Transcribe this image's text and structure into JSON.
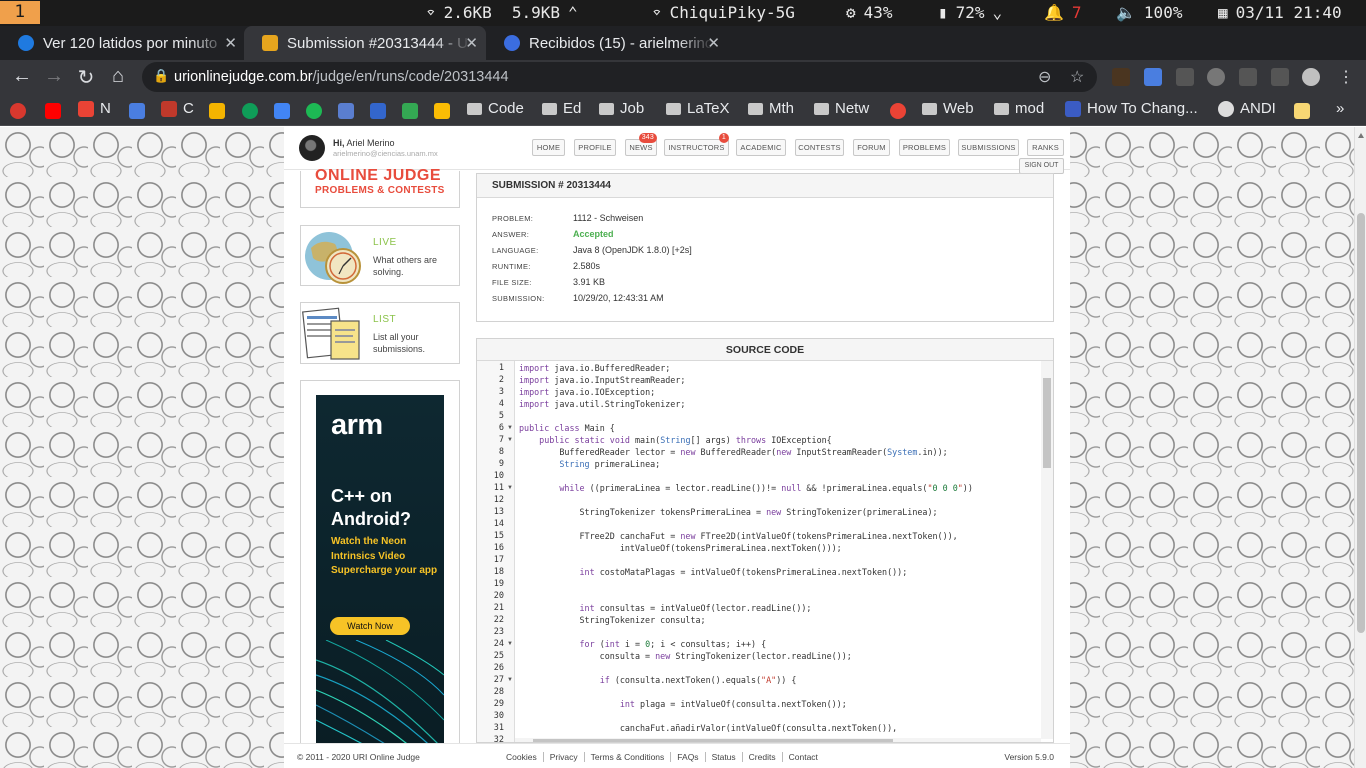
{
  "system": {
    "workspace": "1",
    "net_down": "2.6KB",
    "net_up": "5.9KB",
    "wifi": "ChiquiPiky-5G",
    "cpu": "43%",
    "battery": "72%",
    "notif_count": "7",
    "volume": "100%",
    "datetime": "03/11 21:40"
  },
  "tabs": [
    {
      "title": "Ver 120 latidos por minuto",
      "icon": "edge-icon",
      "color": "#1f7ae0"
    },
    {
      "title": "Submission #20313444 - U",
      "icon": "trophy-icon",
      "color": "#e6a51e"
    },
    {
      "title": "Recibidos (15) - arielmerino",
      "icon": "mail-icon",
      "color": "#3b6de0"
    }
  ],
  "url": {
    "host": "urionlinejudge.com.br",
    "path": "/judge/en/runs/code/20313444"
  },
  "bookmarks": [
    "N",
    "C",
    "Code",
    "Ed",
    "Job",
    "LaTeX",
    "Mth",
    "Netw",
    "Web",
    "mod",
    "How To Chang...",
    "ANDI"
  ],
  "user": {
    "greeting": "Hi,",
    "name": "Ariel Merino",
    "email": "arielmerino@ciencias.unam.mx"
  },
  "menu": [
    {
      "label": "HOME",
      "badge": ""
    },
    {
      "label": "PROFILE",
      "badge": ""
    },
    {
      "label": "NEWS",
      "badge": "343"
    },
    {
      "label": "INSTRUCTORS",
      "badge": "1"
    },
    {
      "label": "ACADEMIC",
      "badge": ""
    },
    {
      "label": "CONTESTS",
      "badge": ""
    },
    {
      "label": "FORUM",
      "badge": ""
    },
    {
      "label": "PROBLEMS",
      "badge": ""
    },
    {
      "label": "SUBMISSIONS",
      "badge": ""
    },
    {
      "label": "RANKS",
      "badge": ""
    }
  ],
  "signout": "SIGN OUT",
  "logo": {
    "line1": "ONLINE JUDGE",
    "line2": "PROBLEMS & CONTESTS"
  },
  "sidebar": [
    {
      "title": "LIVE",
      "desc": "What others are solving."
    },
    {
      "title": "LIST",
      "desc": "List all your submissions."
    }
  ],
  "ad": {
    "brand": "arm",
    "headline": "C++ on Android?",
    "sub": "Watch the Neon Intrinsics Video Supercharge your app",
    "button": "Watch Now"
  },
  "submission": {
    "title": "SUBMISSION # 20313444",
    "rows": [
      {
        "label": "PROBLEM:",
        "value": "1112 - Schweisen"
      },
      {
        "label": "ANSWER:",
        "value": "Accepted"
      },
      {
        "label": "LANGUAGE:",
        "value": "Java 8 (OpenJDK 1.8.0) [+2s]"
      },
      {
        "label": "RUNTIME:",
        "value": "2.580s"
      },
      {
        "label": "FILE SIZE:",
        "value": "3.91 KB"
      },
      {
        "label": "SUBMISSION:",
        "value": "10/29/20, 12:43:31 AM"
      }
    ]
  },
  "source": {
    "title": "SOURCE CODE",
    "lines": [
      "import java.io.BufferedReader;",
      "import java.io.InputStreamReader;",
      "import java.io.IOException;",
      "import java.util.StringTokenizer;",
      "",
      "public class Main {",
      "    public static void main(String[] args) throws IOException{",
      "        BufferedReader lector = new BufferedReader(new InputStreamReader(System.in));",
      "        String primeraLinea;",
      "",
      "        while ((primeraLinea = lector.readLine())!= null && !primeraLinea.equals(\"0 0 0\"))",
      "",
      "            StringTokenizer tokensPrimeraLinea = new StringTokenizer(primeraLinea);",
      "",
      "            FTree2D canchaFut = new FTree2D(intValueOf(tokensPrimeraLinea.nextToken()),",
      "                    intValueOf(tokensPrimeraLinea.nextToken()));",
      "",
      "            int costoMataPlagas = intValueOf(tokensPrimeraLinea.nextToken());",
      "",
      "",
      "            int consultas = intValueOf(lector.readLine());",
      "            StringTokenizer consulta;",
      "",
      "            for (int i = 0; i < consultas; i++) {",
      "                consulta = new StringTokenizer(lector.readLine());",
      "",
      "                if (consulta.nextToken().equals(\"A\")) {",
      "",
      "                    int plaga = intValueOf(consulta.nextToken());",
      "",
      "                    canchaFut.añadirValor(intValueOf(consulta.nextToken()),",
      ""
    ],
    "fold_lines": [
      6,
      7,
      11,
      24,
      27
    ]
  },
  "footer": {
    "copyright": "© 2011 - 2020 URI Online Judge",
    "links": [
      "Cookies",
      "Privacy",
      "Terms & Conditions",
      "FAQs",
      "Status",
      "Credits",
      "Contact"
    ],
    "version": "Version 5.9.0"
  }
}
